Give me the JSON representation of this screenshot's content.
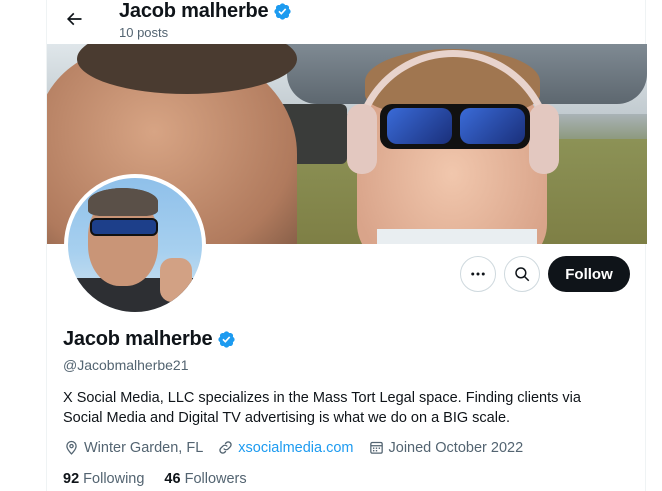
{
  "header": {
    "name": "Jacob malherbe",
    "posts": "10 posts"
  },
  "profile": {
    "display_name": "Jacob malherbe",
    "handle": "@Jacobmalherbe21",
    "bio": "X Social Media, LLC specializes in the Mass Tort Legal space. Finding clients via Social Media and Digital TV advertising is what we do on a BIG scale.",
    "location": "Winter Garden, FL",
    "website": "xsocialmedia.com",
    "joined": "Joined October 2022",
    "following_count": "92",
    "following_label": "Following",
    "followers_count": "46",
    "followers_label": "Followers"
  },
  "actions": {
    "follow_label": "Follow"
  },
  "icons": {
    "back": "arrow-left-icon",
    "verified": "verified-badge-icon",
    "more": "more-horizontal-icon",
    "search": "search-icon",
    "location": "location-pin-icon",
    "link": "link-icon",
    "calendar": "calendar-icon"
  },
  "colors": {
    "verified": "#1d9bf0",
    "link": "#1d9bf0",
    "follow_button": "#0f1419",
    "secondary_text": "#536471"
  }
}
